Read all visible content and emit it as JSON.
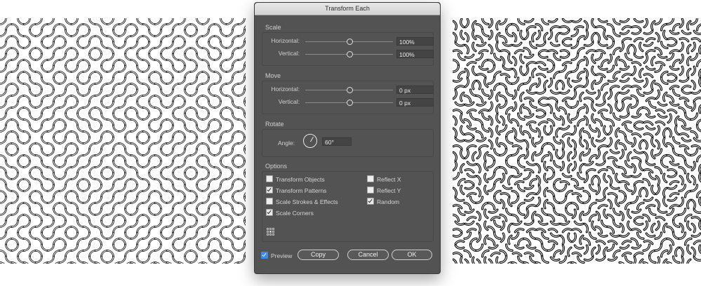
{
  "dialog": {
    "title": "Transform Each",
    "scale": {
      "section_label": "Scale",
      "horizontal": {
        "label": "Horizontal:",
        "value": "100%",
        "slider_fraction": 0.5
      },
      "vertical": {
        "label": "Vertical:",
        "value": "100%",
        "slider_fraction": 0.5
      }
    },
    "move": {
      "section_label": "Move",
      "horizontal": {
        "label": "Horizontal:",
        "value": "0 px",
        "slider_fraction": 0.5
      },
      "vertical": {
        "label": "Vertical:",
        "value": "0 px",
        "slider_fraction": 0.5
      }
    },
    "rotate": {
      "section_label": "Rotate",
      "angle_label": "Angle:",
      "angle_value": "60°",
      "angle_degrees": 60
    },
    "options": {
      "section_label": "Options",
      "transform_objects": {
        "label": "Transform Objects",
        "checked": false
      },
      "transform_patterns": {
        "label": "Transform Patterns",
        "checked": true
      },
      "scale_strokes": {
        "label": "Scale Strokes & Effects",
        "checked": false
      },
      "scale_corners": {
        "label": "Scale Corners",
        "checked": true
      },
      "reflect_x": {
        "label": "Reflect X",
        "checked": false
      },
      "reflect_y": {
        "label": "Reflect Y",
        "checked": false
      },
      "random": {
        "label": "Random",
        "checked": true
      },
      "reference_point_icon": "reference-point-grid-icon"
    },
    "preview": {
      "label": "Preview",
      "checked": true
    },
    "buttons": {
      "copy": "Copy",
      "cancel": "Cancel",
      "ok": "OK"
    }
  },
  "patterns": {
    "left": {
      "description_icon": "truchet-pattern-original",
      "seed": 7
    },
    "right": {
      "description_icon": "truchet-pattern-randomized",
      "seed": 23
    }
  },
  "colors": {
    "dialog_bg": "#535353",
    "pattern_stroke": "#000000",
    "preview_accent": "#3d8bf0"
  }
}
